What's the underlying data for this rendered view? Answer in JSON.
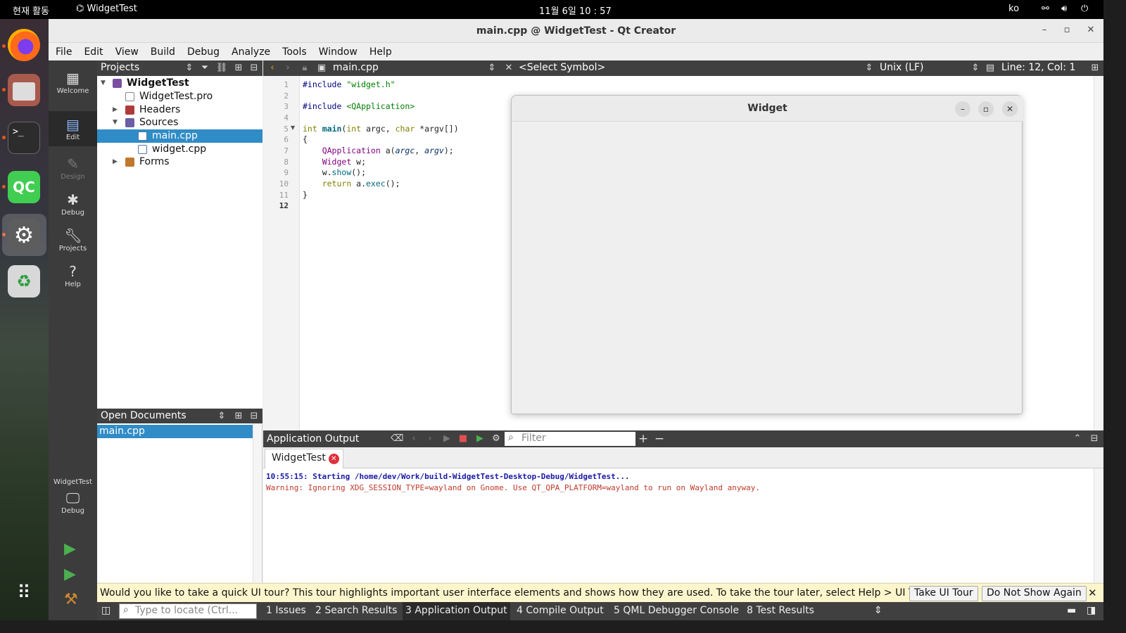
{
  "topbar": {
    "activities": "현재 활동",
    "app_name": "WidgetTest",
    "clock": "11월 6일  10 : 57",
    "lang": "ko"
  },
  "window": {
    "title": "main.cpp @ WidgetTest - Qt Creator"
  },
  "menu": [
    "File",
    "Edit",
    "View",
    "Build",
    "Debug",
    "Analyze",
    "Tools",
    "Window",
    "Help"
  ],
  "modes": [
    {
      "label": "Welcome",
      "icon": "grid-icon",
      "enabled": true
    },
    {
      "label": "Edit",
      "icon": "document-icon",
      "enabled": true,
      "active": true
    },
    {
      "label": "Design",
      "icon": "pencil-icon",
      "enabled": false
    },
    {
      "label": "Debug",
      "icon": "bug-icon",
      "enabled": true
    },
    {
      "label": "Projects",
      "icon": "wrench-icon",
      "enabled": true
    },
    {
      "label": "Help",
      "icon": "question-icon",
      "enabled": true
    }
  ],
  "kit": {
    "project": "WidgetTest",
    "config": "Debug"
  },
  "projects": {
    "title": "Projects",
    "tree": [
      {
        "label": "WidgetTest",
        "bold": true
      },
      {
        "label": "WidgetTest.pro"
      },
      {
        "label": "Headers"
      },
      {
        "label": "Sources"
      },
      {
        "label": "main.cpp",
        "selected": true
      },
      {
        "label": "widget.cpp"
      },
      {
        "label": "Forms"
      }
    ]
  },
  "open_docs": {
    "title": "Open Documents",
    "items": [
      "main.cpp"
    ]
  },
  "editor": {
    "file": "main.cpp",
    "symbol": "<Select Symbol>",
    "line_ending": "Unix (LF)",
    "position": "Line: 12, Col: 1",
    "line_numbers": [
      "1",
      "2",
      "3",
      "4",
      "5",
      "6",
      "7",
      "8",
      "9",
      "10",
      "11",
      "12"
    ]
  },
  "widget_window": {
    "title": "Widget"
  },
  "output": {
    "title": "Application Output",
    "filter_placeholder": "Filter",
    "tab": "WidgetTest",
    "lines": [
      "10:55:15: Starting /home/dev/Work/build-WidgetTest-Desktop-Debug/WidgetTest...",
      "Warning: Ignoring XDG_SESSION_TYPE=wayland on Gnome. Use QT_QPA_PLATFORM=wayland to run on Wayland anyway."
    ]
  },
  "tour": {
    "message": "Would you like to take a quick UI tour? This tour highlights important user interface elements and shows how they are used. To take the tour later, select Help > UI Tour.",
    "take": "Take UI Tour",
    "dont": "Do Not Show Again"
  },
  "statusbar": {
    "locate_placeholder": "Type to locate (Ctrl...",
    "panes": [
      "1  Issues",
      "2  Search Results",
      "3  Application Output",
      "4  Compile Output",
      "5  QML Debugger Console",
      "8  Test Results"
    ]
  },
  "colors": {
    "selection": "#308cc6",
    "panel_header": "#404040",
    "mode_bar": "#3c3c3c",
    "tour_bg": "#fdf6cc",
    "output_start": "#1a1aa6",
    "output_warning": "#c0392b"
  }
}
